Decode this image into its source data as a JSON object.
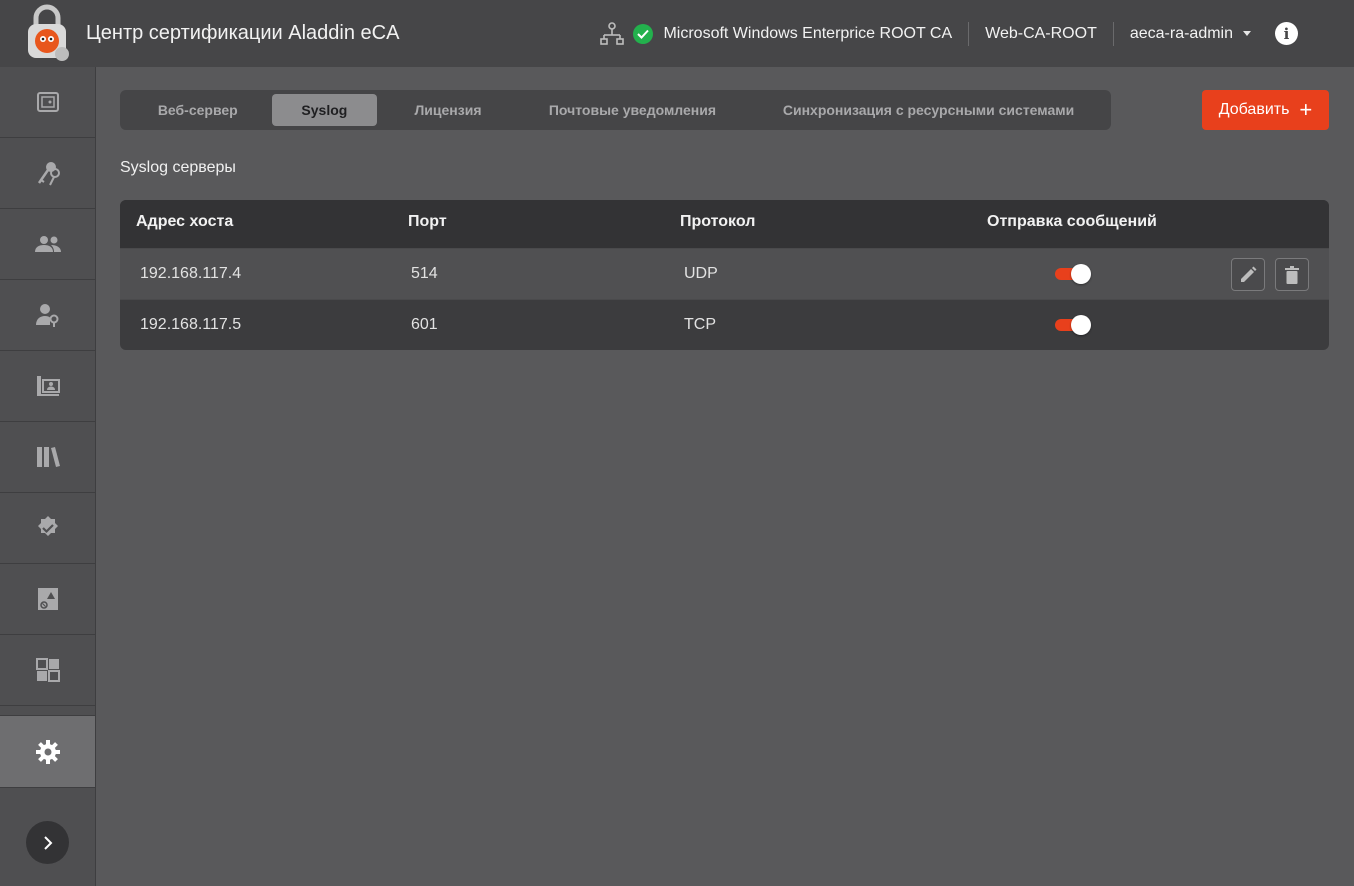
{
  "header": {
    "title": "Центр сертификации Aladdin eCA",
    "ca_name": "Microsoft Windows Enterprice ROOT CA",
    "ca_server": "Web-CA-ROOT",
    "user": "aeca-ra-admin"
  },
  "tabs": [
    {
      "label": "Веб-сервер",
      "active": false
    },
    {
      "label": "Syslog",
      "active": true
    },
    {
      "label": "Лицензия",
      "active": false
    },
    {
      "label": "Почтовые уведомления",
      "active": false
    },
    {
      "label": "Синхронизация с ресурсными системами",
      "active": false
    }
  ],
  "add_button": {
    "label": "Добавить"
  },
  "section_title": "Syslog серверы",
  "table": {
    "columns": [
      "Адрес хоста",
      "Порт",
      "Протокол",
      "Отправка сообщений"
    ],
    "rows": [
      {
        "host": "192.168.117.4",
        "port": "514",
        "protocol": "UDP",
        "sending": true
      },
      {
        "host": "192.168.117.5",
        "port": "601",
        "protocol": "TCP",
        "sending": true
      }
    ]
  },
  "colors": {
    "accent": "#e8401c",
    "status_ok": "#23b14d"
  },
  "icons": {
    "sidebar": [
      "dashboard-icon",
      "keys-icon",
      "users-icon",
      "user-key-icon",
      "certificate-user-icon",
      "library-icon",
      "verified-icon",
      "certificate-warning-icon",
      "templates-icon",
      "settings-icon"
    ],
    "row_actions": [
      "edit-icon",
      "delete-icon"
    ]
  }
}
